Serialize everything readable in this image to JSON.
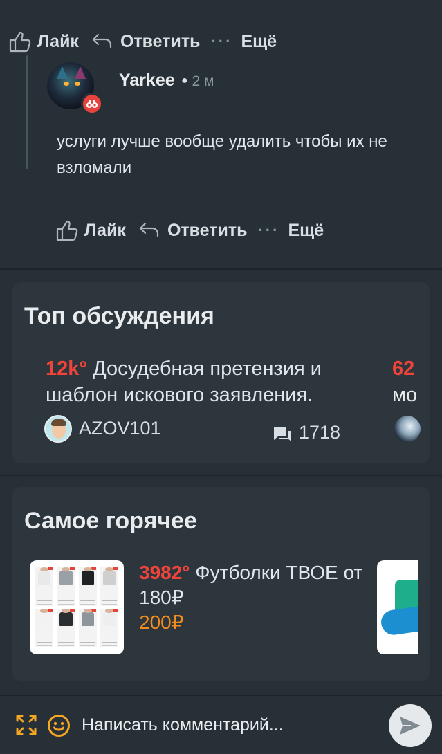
{
  "prev_comment_actions": {
    "like": "Лайк",
    "reply": "Ответить",
    "more_dots": "···",
    "more": "Ещё"
  },
  "comment": {
    "username": "Yarkee",
    "time_separator": "●",
    "time": "2 м",
    "text": "услуги лучше вообще удалить чтобы их не взломали",
    "actions": {
      "like": "Лайк",
      "reply": "Ответить",
      "more_dots": "···",
      "more": "Ещё"
    }
  },
  "top_discussions": {
    "title": "Топ обсуждения",
    "items": [
      {
        "temperature": "12k°",
        "title": "Досудебная претензия и шаблон искового заявления.",
        "author": "AZOV101",
        "comments": "1718"
      }
    ],
    "peek": {
      "temperature": "62",
      "title_fragment": "мо"
    }
  },
  "hottest": {
    "title": "Самое горячее",
    "items": [
      {
        "temperature": "3982°",
        "title": "Футболки ТВОЕ от 180₽",
        "price": "200₽"
      }
    ]
  },
  "composer": {
    "placeholder": "Написать комментарий..."
  },
  "colors": {
    "background": "#273036",
    "card": "#2d363c",
    "temperature": "#f0433a",
    "price": "#f28c1c",
    "accent": "#f5a623"
  },
  "icons": [
    "like-icon",
    "reply-icon",
    "comments-icon",
    "expand-icon",
    "emoji-icon",
    "send-icon",
    "badge-icon"
  ]
}
